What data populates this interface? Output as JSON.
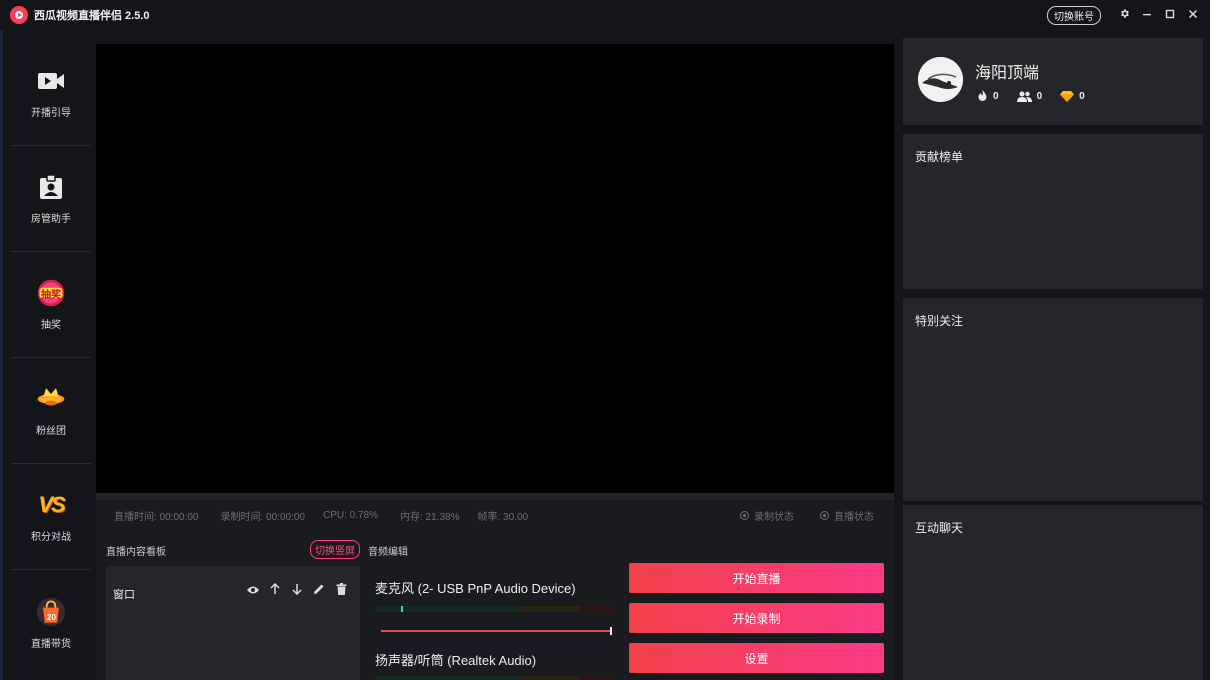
{
  "app": {
    "title": "西瓜视频直播伴侣 2.5.0",
    "switch_account": "切换账号"
  },
  "sidebar": {
    "items": [
      {
        "label": "开播引导",
        "icon": "camera-icon"
      },
      {
        "label": "房管助手",
        "icon": "badge-icon"
      },
      {
        "label": "抽奖",
        "icon": "lottery-icon",
        "badge_text": "抽奖"
      },
      {
        "label": "粉丝团",
        "icon": "fan-club-icon"
      },
      {
        "label": "积分对战",
        "icon": "vs-icon",
        "badge_text": "VS"
      },
      {
        "label": "直播带货",
        "icon": "shopping-bag-icon",
        "badge_text": "20"
      }
    ]
  },
  "status": {
    "live_time": "直播时间: 00:00:00",
    "record_time": "录制时间: 00:00:00",
    "cpu": "CPU: 0.78%",
    "memory": "内存: 21.38%",
    "fps": "帧率: 30.00",
    "record_state": "录制状态",
    "live_state": "直播状态"
  },
  "content_panel": {
    "title": "直播内容看板",
    "vertical_button": "切换竖屏",
    "source_name": "窗口"
  },
  "audio": {
    "title": "音频编辑",
    "mic_label": "麦克风 (2- USB PnP Audio Device)",
    "mic_level": 0.11,
    "mic_volume": 1.0,
    "speaker_label": "扬声器/听筒 (Realtek Audio)"
  },
  "actions": {
    "start_live": "开始直播",
    "start_record": "开始录制",
    "settings": "设置"
  },
  "profile": {
    "username": "海阳顶端",
    "likes": "0",
    "followers": "0",
    "diamonds": "0"
  },
  "panels": {
    "contribution": "贡献榜单",
    "special_follow": "特别关注",
    "chat": "互动聊天"
  },
  "colors": {
    "accent_start": "#f2404a",
    "accent_end": "#fb3b86",
    "panel": "#25262a",
    "background": "#141518"
  }
}
